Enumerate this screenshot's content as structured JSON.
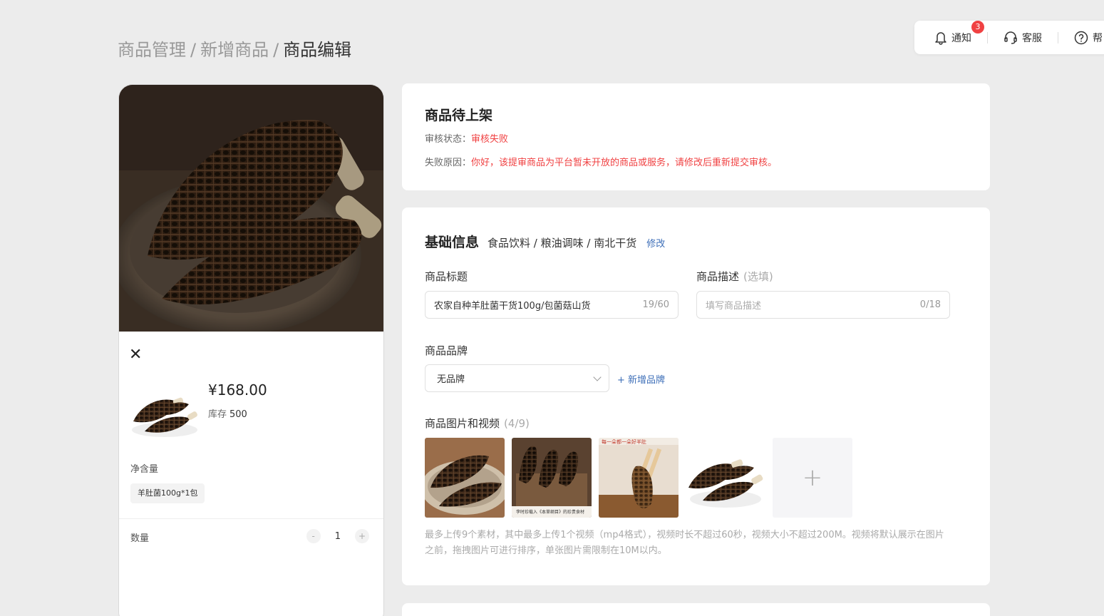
{
  "breadcrumb": {
    "items": [
      "商品管理",
      "新增商品"
    ],
    "current": "商品编辑",
    "separator": "/"
  },
  "topbar": {
    "notify_label": "通知",
    "notify_count": "3",
    "service_label": "客服",
    "help_label": "帮"
  },
  "preview": {
    "price": "¥168.00",
    "stock_label": "库存",
    "stock_value": "500",
    "spec_label": "净含量",
    "spec_option": "羊肚菌100g*1包",
    "qty_label": "数量",
    "qty_minus": "-",
    "qty_value": "1",
    "qty_plus": "+"
  },
  "status_card": {
    "title": "商品待上架",
    "audit_label": "审核状态：",
    "audit_value": "审核失败",
    "reason_label": "失败原因：",
    "reason_value": "你好，该提审商品为平台暂未开放的商品或服务，请修改后重新提交审核。"
  },
  "basic": {
    "title": "基础信息",
    "category_path": "食品饮料 / 粮油调味 / 南北干货",
    "edit_label": "修改",
    "title_field": {
      "label": "商品标题",
      "value": "农家自种羊肚菌干货100g/包菌菇山货",
      "count": "19/60"
    },
    "desc_field": {
      "label": "商品描述",
      "optional": "(选填)",
      "placeholder": "填写商品描述",
      "count": "0/18"
    },
    "brand_field": {
      "label": "商品品牌",
      "value": "无品牌",
      "add_label": "+ 新增品牌"
    },
    "media": {
      "label": "商品图片和视频",
      "count": "(4/9)",
      "add_symbol": "+",
      "hint": "最多上传9个素材，其中最多上传1个视频（mp4格式），视频时长不超过60秒，视频大小不超过200M。视频将默认展示在图片之前，拖拽图片可进行排序，单张图片需限制在10M以内。",
      "thumb2_caption": "李时珍载入《本草纲目》的珍贵食材",
      "thumb3_caption": "每一朵都一朵好羊肚"
    }
  },
  "colors": {
    "accent_link": "#3e6fb8",
    "error_red": "#f04142",
    "background": "#ececec"
  }
}
